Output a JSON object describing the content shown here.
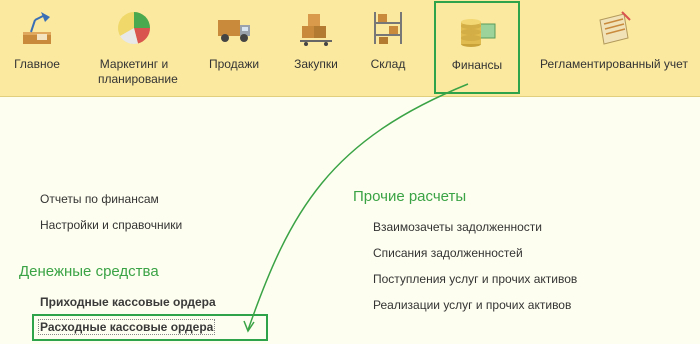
{
  "sections": [
    {
      "label": "Главное",
      "icon": "desk-lamp-icon"
    },
    {
      "label": "Маркетинг и планирование",
      "icon": "pie-chart-icon"
    },
    {
      "label": "Продажи",
      "icon": "truck-icon"
    },
    {
      "label": "Закупки",
      "icon": "boxes-cart-icon"
    },
    {
      "label": "Склад",
      "icon": "warehouse-shelf-icon"
    },
    {
      "label": "Финансы",
      "icon": "coins-icon",
      "active": true
    },
    {
      "label": "Регламентированный учет",
      "icon": "ledger-icon"
    }
  ],
  "left_links": {
    "reports": "Отчеты по финансам",
    "settings": "Настройки и справочники"
  },
  "money_group": {
    "title": "Денежные средства",
    "items": [
      "Приходные кассовые ордера",
      "Расходные кассовые ордера"
    ]
  },
  "other_group": {
    "title": "Прочие расчеты",
    "items": [
      "Взаимозачеты задолженности",
      "Списания задолженностей",
      "Поступления услуг и прочих активов",
      "Реализации услуг и прочих активов"
    ]
  },
  "colors": {
    "toolbar_bg": "#fbe9a0",
    "content_bg": "#fefef0",
    "accent_green": "#2fa34a",
    "group_title": "#3aa345"
  }
}
